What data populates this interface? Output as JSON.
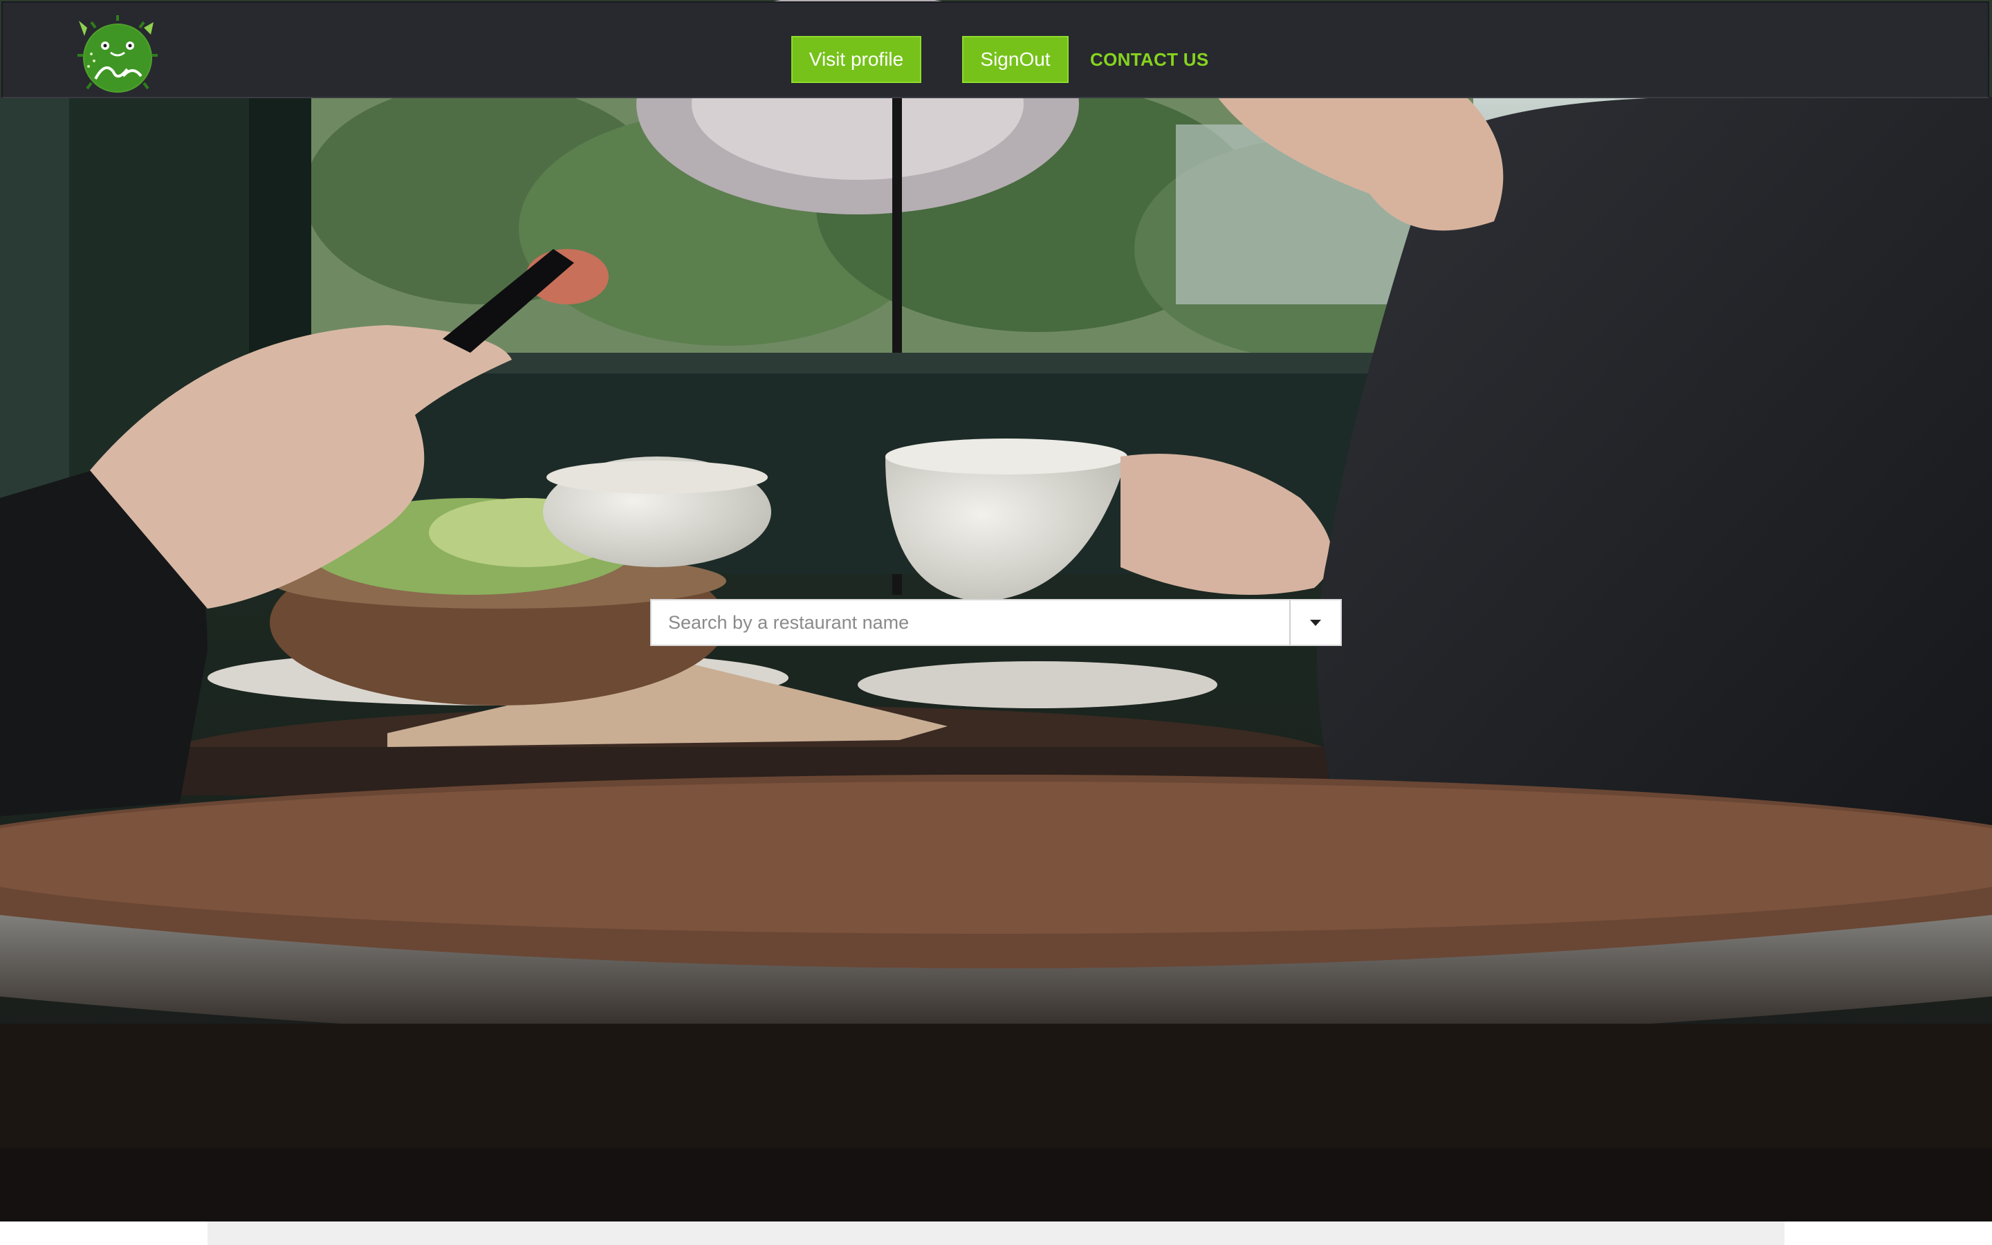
{
  "navbar": {
    "logo_icon": "pufferfish-logo-icon",
    "visit_profile_label": "Visit profile",
    "signout_label": "SignOut",
    "contact_label": "CONTACT US"
  },
  "search": {
    "placeholder": "Search by a restaurant name",
    "dropdown_icon": "caret-down-icon"
  },
  "hero": {
    "background_image": "cafe-table-scene"
  },
  "colors": {
    "navbar_bg": "#27292f",
    "accent_green": "#76c21a",
    "contact_green": "#86d41e"
  }
}
